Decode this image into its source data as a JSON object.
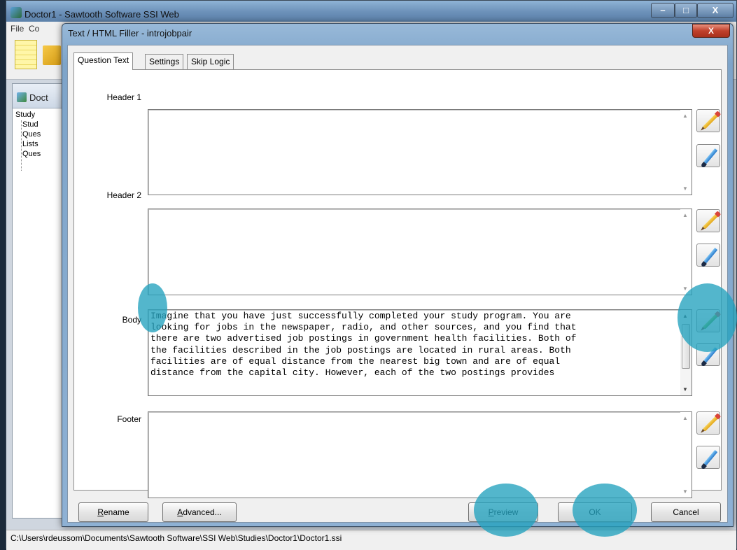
{
  "main_window": {
    "title": "Doctor1 - Sawtooth Software SSI Web",
    "controls": {
      "minimize": "–",
      "maximize": "□",
      "close": "X"
    },
    "menu": [
      "File",
      "Co"
    ],
    "side_panel": {
      "title": "Doct",
      "tree": [
        "Study",
        "Stud",
        "Ques",
        "Lists",
        "Ques"
      ]
    },
    "status_path": "C:\\Users\\rdeussom\\Documents\\Sawtooth Software\\SSI Web\\Studies\\Doctor1\\Doctor1.ssi"
  },
  "dialog": {
    "title": "Text / HTML Filler - introjobpair",
    "close": "X",
    "tabs": [
      {
        "label": "Question Text",
        "active": true
      },
      {
        "label": "Settings",
        "active": false
      },
      {
        "label": "Skip Logic",
        "active": false
      }
    ],
    "fields": {
      "header1": {
        "label": "Header 1",
        "value": ""
      },
      "header2": {
        "label": "Header 2",
        "value": ""
      },
      "body": {
        "label": "Body",
        "value": "Imagine that you have just successfully completed your study program. You are\nlooking for jobs in the newspaper, radio, and other sources, and you find that\nthere are two advertised job postings in government health facilities. Both of\nthe facilities described in the job postings are located in rural areas. Both\nfacilities are of equal distance from the nearest big town and are of equal\ndistance from the capital city. However, each of the two postings provides"
      },
      "footer": {
        "label": "Footer",
        "value": ""
      }
    },
    "buttons": {
      "rename": {
        "pre": "",
        "hot": "R",
        "post": "ename"
      },
      "advanced": {
        "pre": "",
        "hot": "A",
        "post": "dvanced..."
      },
      "preview": {
        "pre": "",
        "hot": "P",
        "post": "review"
      },
      "ok": {
        "label": "OK"
      },
      "cancel": {
        "label": "Cancel"
      }
    }
  },
  "highlight_color": "#22a2be"
}
